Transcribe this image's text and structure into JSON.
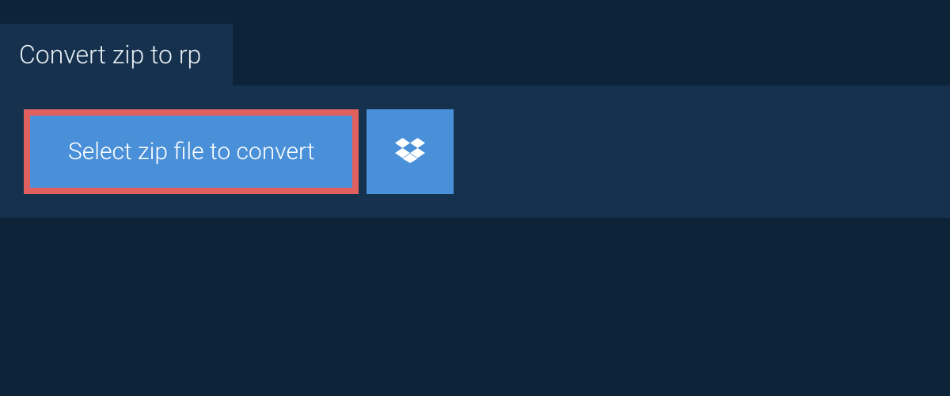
{
  "tab": {
    "title": "Convert zip to rp"
  },
  "actions": {
    "select_label": "Select zip file to convert"
  }
}
